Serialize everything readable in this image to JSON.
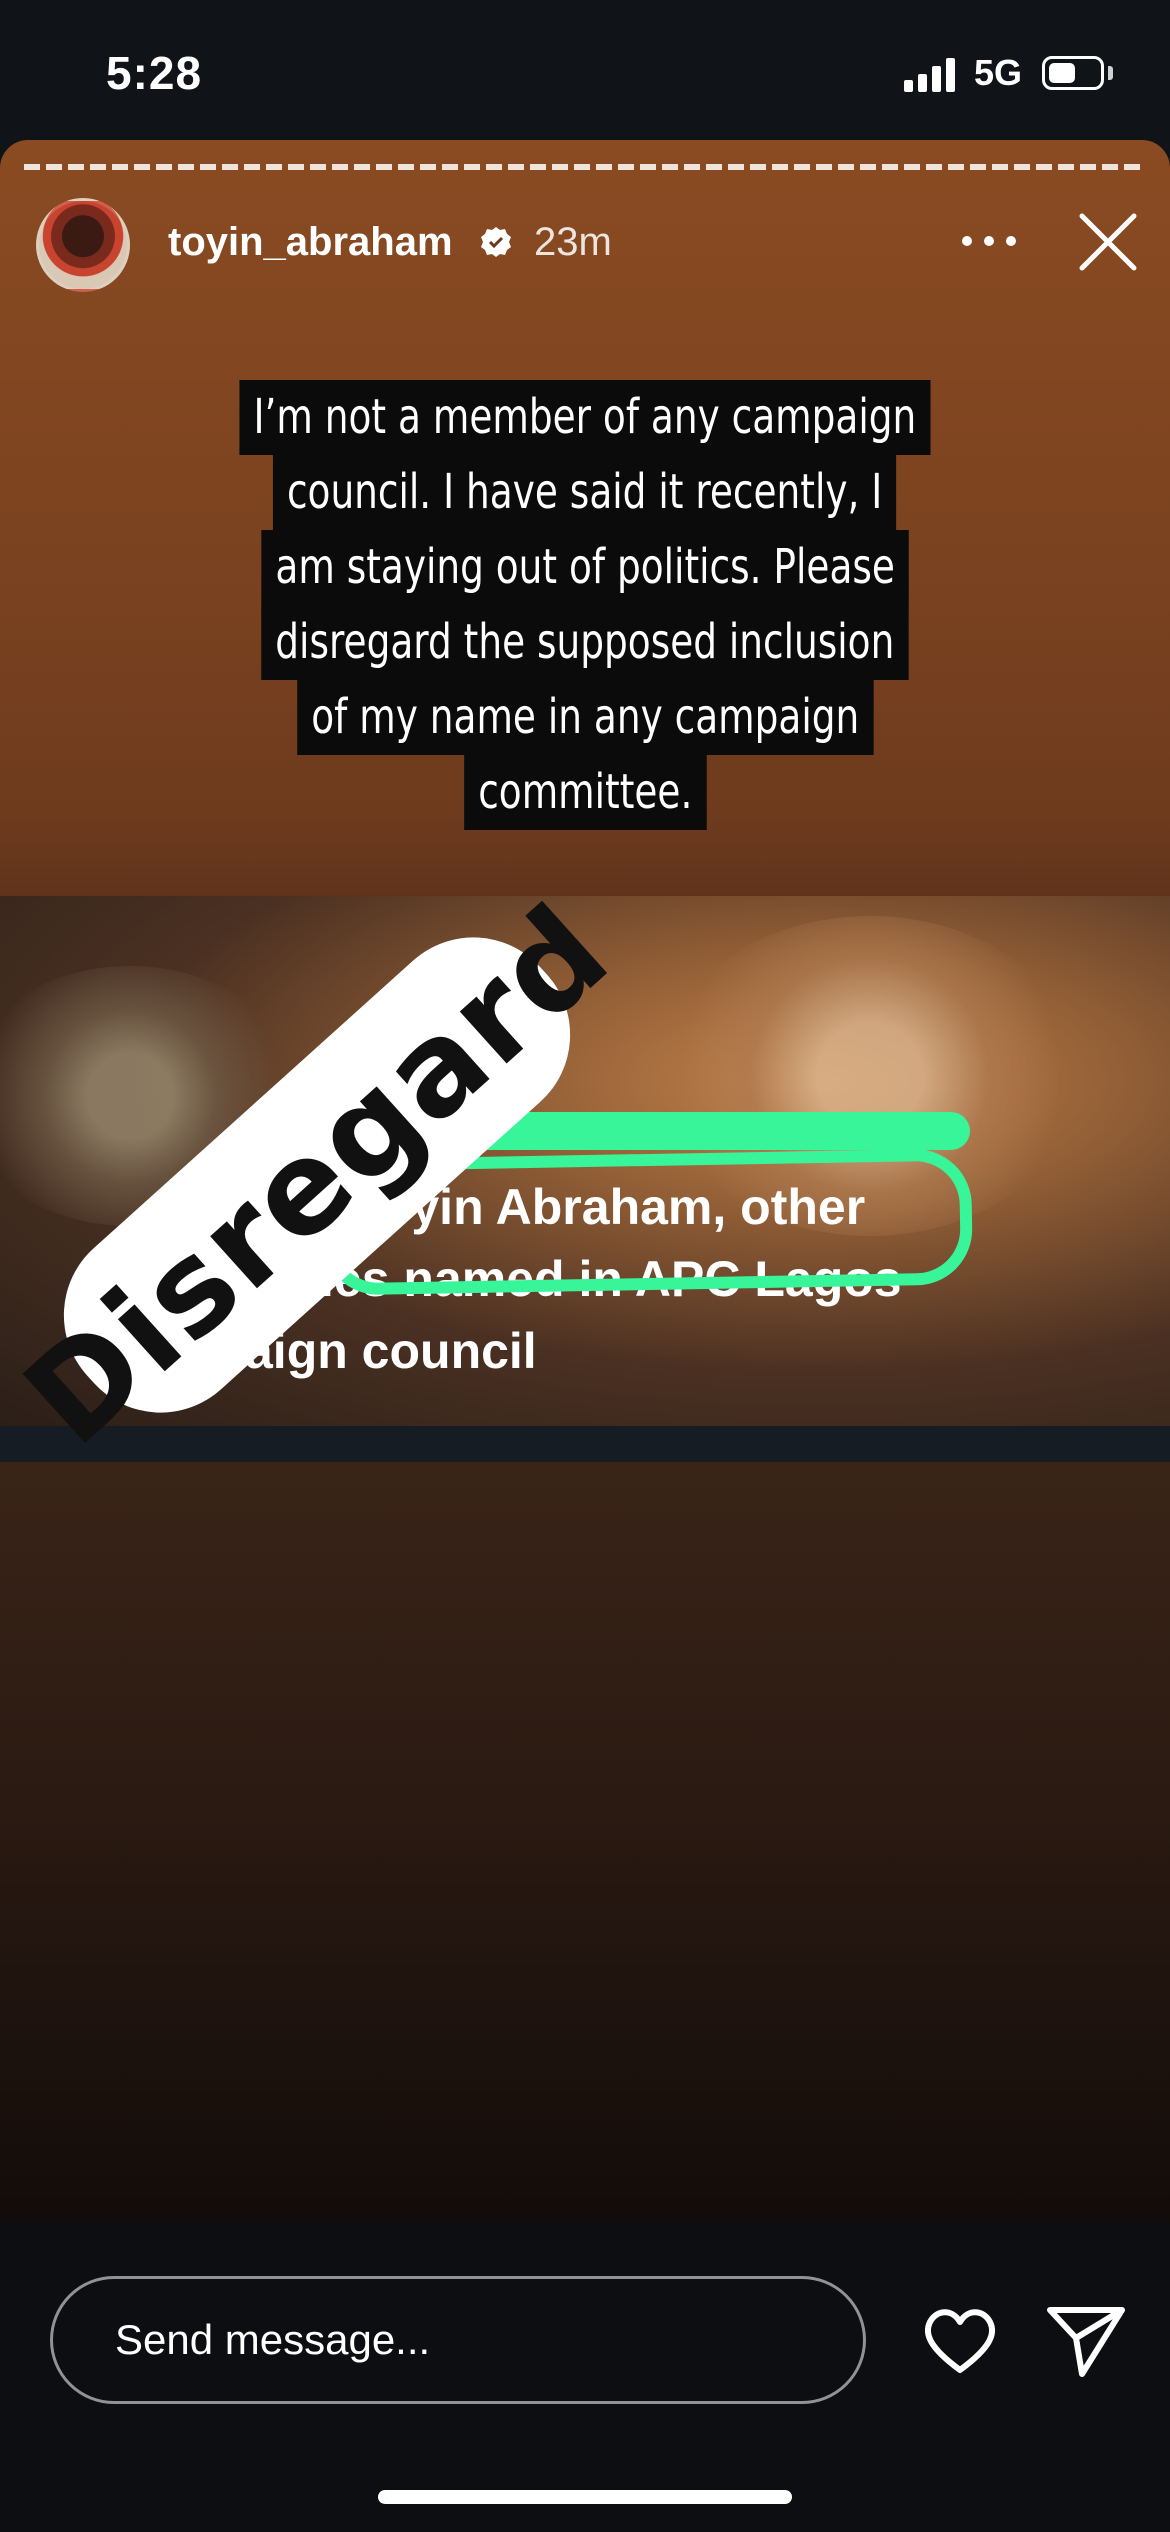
{
  "status_bar": {
    "time": "5:28",
    "network": "5G",
    "battery_level": 0.55
  },
  "story": {
    "username": "toyin_abraham",
    "verified": true,
    "time_ago": "23m",
    "caption_lines": [
      "I’m not a member of any campaign",
      "council. I have said it recently, I",
      "am staying out of politics. Please",
      "disregard the supposed inclusion",
      "of my name in any campaign",
      "committee."
    ],
    "news_lines": [
      "Toyin Abraham, other",
      "rities named in APC Lagos",
      "mpaign council"
    ],
    "sticker_text": "Disregard",
    "marker_color": "#39f59a"
  },
  "reply": {
    "placeholder": "Send message..."
  },
  "icons": [
    "signal-icon",
    "battery-icon",
    "verified-badge-icon",
    "more-options-icon",
    "close-icon",
    "heart-icon",
    "send-icon"
  ]
}
